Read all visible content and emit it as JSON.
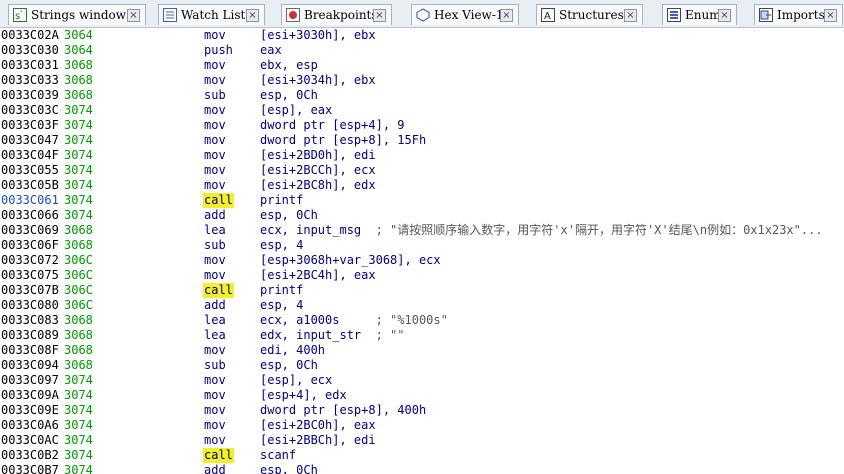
{
  "tabs": [
    {
      "label": "Strings window",
      "icon": "strings-icon",
      "close": "×"
    },
    {
      "label": "Watch List",
      "icon": "watch-list-icon",
      "close": "×"
    },
    {
      "label": "Breakpoints",
      "icon": "breakpoints-icon",
      "close": "×"
    },
    {
      "label": "Hex View-1",
      "icon": "hex-view-icon",
      "close": "×"
    },
    {
      "label": "Structures",
      "icon": "structures-icon",
      "close": "×"
    },
    {
      "label": "Enums",
      "icon": "enums-icon",
      "close": "×"
    },
    {
      "label": "Imports",
      "icon": "imports-icon",
      "close": "×"
    }
  ],
  "colors": {
    "call_highlight": "#f3f028",
    "address": "#000000",
    "address_current": "#1b4dbf",
    "stack_delta": "#009a00",
    "instruction": "#00007f",
    "comment": "#55555f"
  },
  "listing": [
    {
      "addr": "0033C02A",
      "sp": "3064",
      "mn": "mov",
      "ops": "[esi+3030h], ebx",
      "cmt": ""
    },
    {
      "addr": "0033C030",
      "sp": "3064",
      "mn": "push",
      "ops": "eax",
      "cmt": ""
    },
    {
      "addr": "0033C031",
      "sp": "3068",
      "mn": "mov",
      "ops": "ebx, esp",
      "cmt": ""
    },
    {
      "addr": "0033C033",
      "sp": "3068",
      "mn": "mov",
      "ops": "[esi+3034h], ebx",
      "cmt": ""
    },
    {
      "addr": "0033C039",
      "sp": "3068",
      "mn": "sub",
      "ops": "esp, 0Ch",
      "cmt": ""
    },
    {
      "addr": "0033C03C",
      "sp": "3074",
      "mn": "mov",
      "ops": "[esp], eax",
      "cmt": ""
    },
    {
      "addr": "0033C03F",
      "sp": "3074",
      "mn": "mov",
      "ops": "dword ptr [esp+4], 9",
      "cmt": ""
    },
    {
      "addr": "0033C047",
      "sp": "3074",
      "mn": "mov",
      "ops": "dword ptr [esp+8], 15Fh",
      "cmt": ""
    },
    {
      "addr": "0033C04F",
      "sp": "3074",
      "mn": "mov",
      "ops": "[esi+2BD0h], edi",
      "cmt": ""
    },
    {
      "addr": "0033C055",
      "sp": "3074",
      "mn": "mov",
      "ops": "[esi+2BCCh], ecx",
      "cmt": ""
    },
    {
      "addr": "0033C05B",
      "sp": "3074",
      "mn": "mov",
      "ops": "[esi+2BC8h], edx",
      "cmt": ""
    },
    {
      "addr": "0033C061",
      "sp": "3074",
      "mn": "call",
      "ops": "printf",
      "cmt": "",
      "current": true
    },
    {
      "addr": "0033C066",
      "sp": "3074",
      "mn": "add",
      "ops": "esp, 0Ch",
      "cmt": ""
    },
    {
      "addr": "0033C069",
      "sp": "3068",
      "mn": "lea",
      "ops": "ecx, input_msg  ",
      "cmt": "; \"请按照顺序输入数字，用字符'x'隔开，用字符'X'结尾\\n例如：0x1x23x\"..."
    },
    {
      "addr": "0033C06F",
      "sp": "3068",
      "mn": "sub",
      "ops": "esp, 4",
      "cmt": ""
    },
    {
      "addr": "0033C072",
      "sp": "306C",
      "mn": "mov",
      "ops": "[esp+3068h+var_3068], ecx",
      "cmt": ""
    },
    {
      "addr": "0033C075",
      "sp": "306C",
      "mn": "mov",
      "ops": "[esi+2BC4h], eax",
      "cmt": ""
    },
    {
      "addr": "0033C07B",
      "sp": "306C",
      "mn": "call",
      "ops": "printf",
      "cmt": ""
    },
    {
      "addr": "0033C080",
      "sp": "306C",
      "mn": "add",
      "ops": "esp, 4",
      "cmt": ""
    },
    {
      "addr": "0033C083",
      "sp": "3068",
      "mn": "lea",
      "ops": "ecx, a1000s     ",
      "cmt": "; \"%1000s\""
    },
    {
      "addr": "0033C089",
      "sp": "3068",
      "mn": "lea",
      "ops": "edx, input_str  ",
      "cmt": "; \"\""
    },
    {
      "addr": "0033C08F",
      "sp": "3068",
      "mn": "mov",
      "ops": "edi, 400h",
      "cmt": ""
    },
    {
      "addr": "0033C094",
      "sp": "3068",
      "mn": "sub",
      "ops": "esp, 0Ch",
      "cmt": ""
    },
    {
      "addr": "0033C097",
      "sp": "3074",
      "mn": "mov",
      "ops": "[esp], ecx",
      "cmt": ""
    },
    {
      "addr": "0033C09A",
      "sp": "3074",
      "mn": "mov",
      "ops": "[esp+4], edx",
      "cmt": ""
    },
    {
      "addr": "0033C09E",
      "sp": "3074",
      "mn": "mov",
      "ops": "dword ptr [esp+8], 400h",
      "cmt": ""
    },
    {
      "addr": "0033C0A6",
      "sp": "3074",
      "mn": "mov",
      "ops": "[esi+2BC0h], eax",
      "cmt": ""
    },
    {
      "addr": "0033C0AC",
      "sp": "3074",
      "mn": "mov",
      "ops": "[esi+2BBCh], edi",
      "cmt": ""
    },
    {
      "addr": "0033C0B2",
      "sp": "3074",
      "mn": "call",
      "ops": "scanf",
      "cmt": ""
    },
    {
      "addr": "0033C0B7",
      "sp": "3074",
      "mn": "add",
      "ops": "esp, 0Ch",
      "cmt": ""
    }
  ]
}
